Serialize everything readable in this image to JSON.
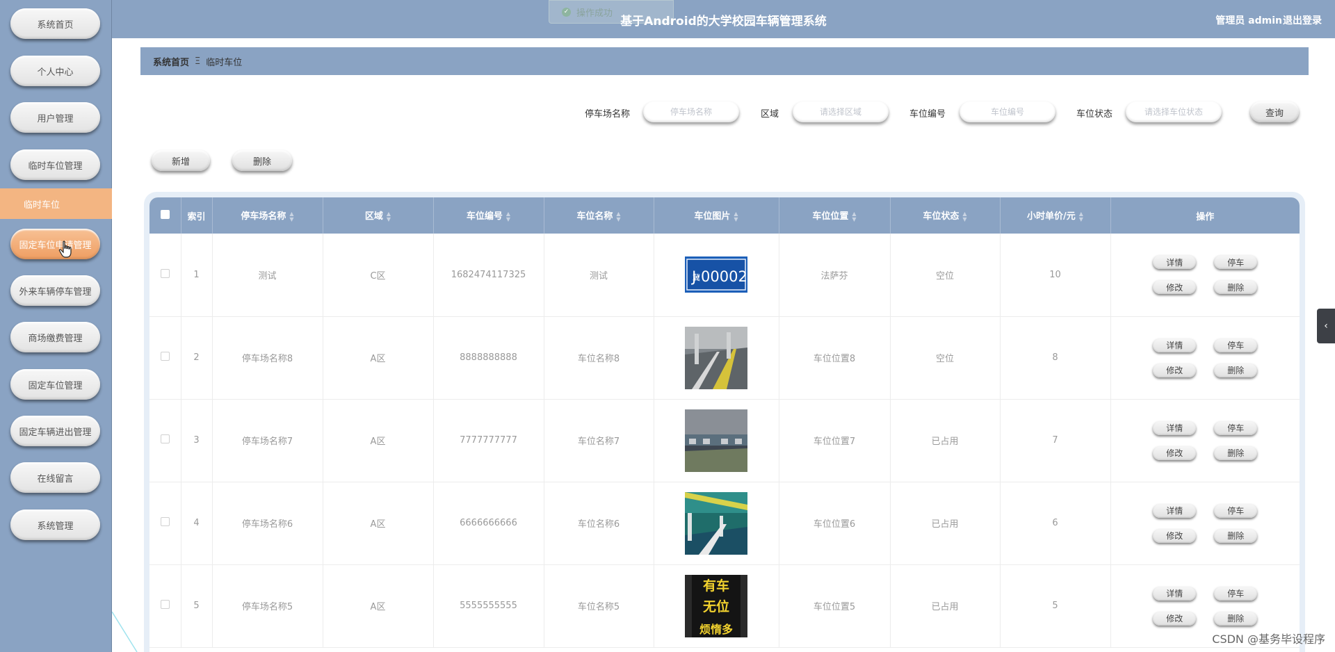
{
  "sidebar": {
    "items": [
      {
        "label": "系统首页"
      },
      {
        "label": "个人中心"
      },
      {
        "label": "用户管理"
      },
      {
        "label": "临时车位管理"
      },
      {
        "label": "固定车位申请管理"
      },
      {
        "label": "外来车辆停车管理"
      },
      {
        "label": "商场缴费管理"
      },
      {
        "label": "固定车位管理"
      },
      {
        "label": "固定车辆进出管理"
      },
      {
        "label": "在线留言"
      },
      {
        "label": "系统管理"
      }
    ],
    "submenu_label": "临时车位"
  },
  "header": {
    "title": "基于Android的大学校园车辆管理系统",
    "user": "管理员 admin",
    "logout": "退出登录",
    "toast": "操作成功"
  },
  "breadcrumb": {
    "home": "系统首页",
    "separator": "Ξ",
    "current": "临时车位"
  },
  "search": {
    "lot_name_label": "停车场名称",
    "lot_name_placeholder": "停车场名称",
    "area_label": "区域",
    "area_placeholder": "请选择区域",
    "space_no_label": "车位编号",
    "space_no_placeholder": "车位编号",
    "status_label": "车位状态",
    "status_placeholder": "请选择车位状态",
    "query_button": "查询"
  },
  "actions": {
    "add_button": "新增",
    "delete_button": "删除"
  },
  "table": {
    "headers": {
      "index": "索引",
      "lot_name": "停车场名称",
      "area": "区域",
      "space_no": "车位编号",
      "space_name": "车位名称",
      "image": "车位图片",
      "location": "车位位置",
      "status": "车位状态",
      "price": "小时单价/元",
      "ops": "操作"
    },
    "op_labels": {
      "detail": "详情",
      "park": "停车",
      "edit": "修改",
      "delete": "删除"
    },
    "rows": [
      {
        "index": "1",
        "lot_name": "测试",
        "area": "C区",
        "space_no": "1682474117325",
        "space_name": "测试",
        "image": "license-plate",
        "location": "法萨芬",
        "status": "空位",
        "price": "10",
        "plate_text": "J·00002",
        "plate_prefix": "冀"
      },
      {
        "index": "2",
        "lot_name": "停车场名称8",
        "area": "A区",
        "space_no": "8888888888",
        "space_name": "车位名称8",
        "image": "garage-photo-1",
        "location": "车位位置8",
        "status": "空位",
        "price": "8"
      },
      {
        "index": "3",
        "lot_name": "停车场名称7",
        "area": "A区",
        "space_no": "7777777777",
        "space_name": "车位名称7",
        "image": "garage-photo-2",
        "location": "车位位置7",
        "status": "已占用",
        "price": "7"
      },
      {
        "index": "4",
        "lot_name": "停车场名称6",
        "area": "A区",
        "space_no": "6666666666",
        "space_name": "车位名称6",
        "image": "garage-photo-3",
        "location": "车位位置6",
        "status": "已占用",
        "price": "6"
      },
      {
        "index": "5",
        "lot_name": "停车场名称5",
        "area": "A区",
        "space_no": "5555555555",
        "space_name": "车位名称5",
        "image": "sign-photo",
        "location": "车位位置5",
        "status": "已占用",
        "price": "5",
        "sign_lines": [
          "有车",
          "无位",
          "烦惰多"
        ]
      }
    ]
  },
  "watermark": "CSDN @基务毕设程序",
  "colors": {
    "primary": "#8aa3c3",
    "active": "#ef9e62",
    "submenu": "#f3b582"
  }
}
